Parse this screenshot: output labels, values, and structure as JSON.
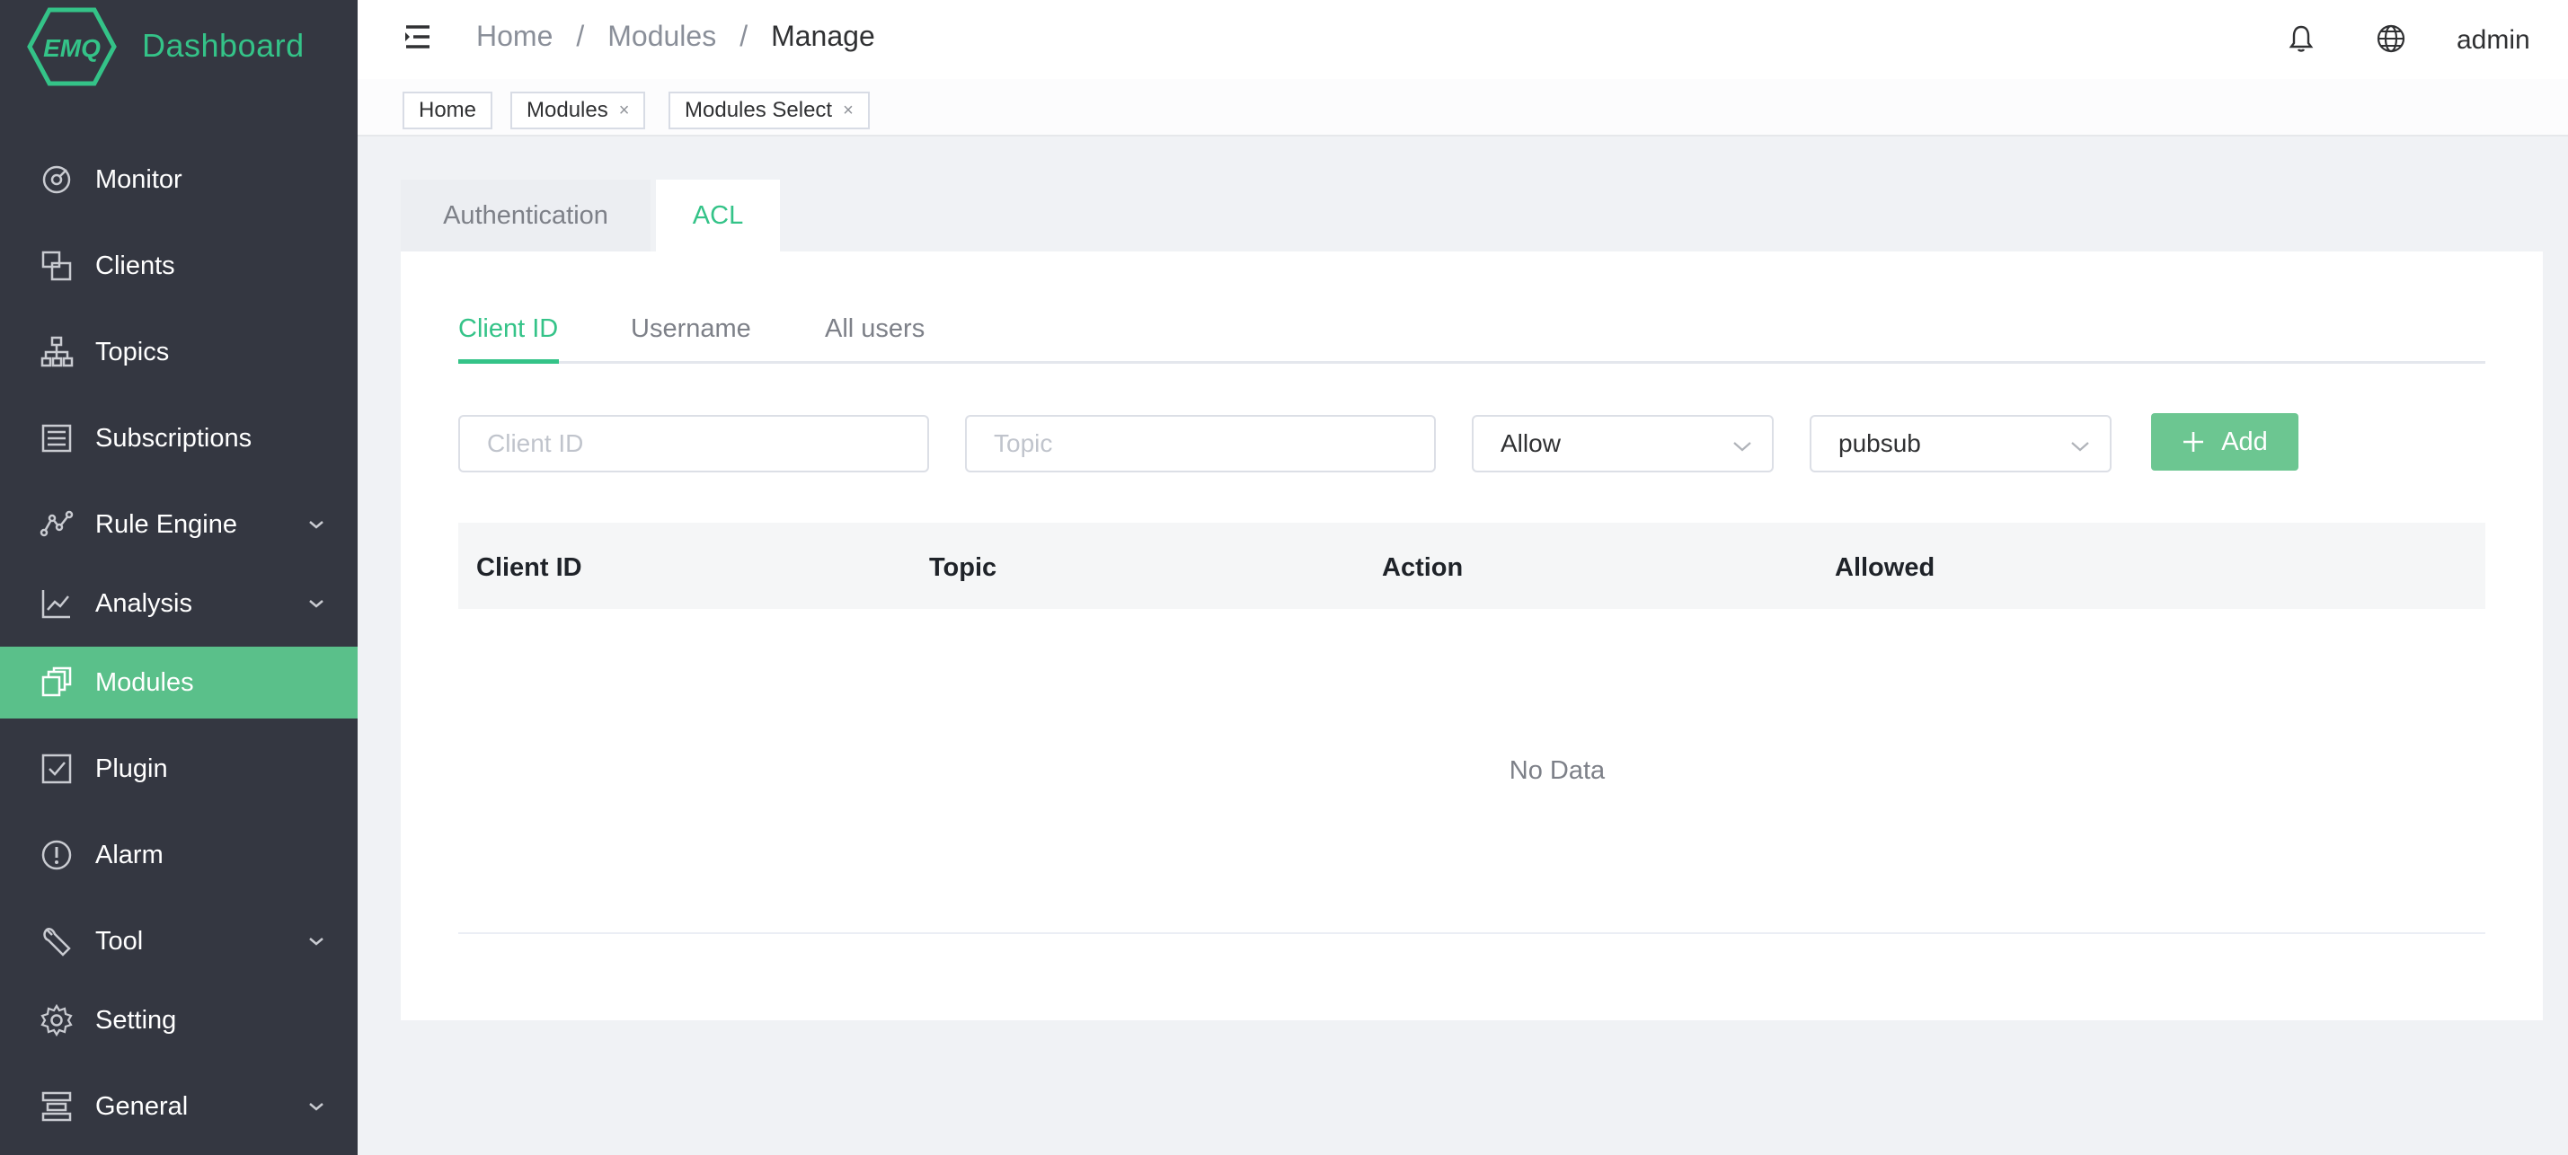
{
  "brand": {
    "logo_text": "EMQ",
    "title": "Dashboard"
  },
  "sidebar": {
    "items": [
      {
        "label": "Monitor",
        "icon": "dashboard-icon",
        "expandable": false,
        "active": false
      },
      {
        "label": "Clients",
        "icon": "clients-icon",
        "expandable": false,
        "active": false
      },
      {
        "label": "Topics",
        "icon": "topics-icon",
        "expandable": false,
        "active": false
      },
      {
        "label": "Subscriptions",
        "icon": "subscriptions-icon",
        "expandable": false,
        "active": false
      },
      {
        "label": "Rule Engine",
        "icon": "rule-engine-icon",
        "expandable": true,
        "active": false
      },
      {
        "label": "Analysis",
        "icon": "analysis-icon",
        "expandable": true,
        "active": false
      },
      {
        "label": "Modules",
        "icon": "modules-icon",
        "expandable": false,
        "active": true
      },
      {
        "label": "Plugin",
        "icon": "plugin-icon",
        "expandable": false,
        "active": false
      },
      {
        "label": "Alarm",
        "icon": "alarm-icon",
        "expandable": false,
        "active": false
      },
      {
        "label": "Tool",
        "icon": "tool-icon",
        "expandable": true,
        "active": false
      },
      {
        "label": "Setting",
        "icon": "gear-icon",
        "expandable": false,
        "active": false
      },
      {
        "label": "General",
        "icon": "general-icon",
        "expandable": true,
        "active": false
      }
    ]
  },
  "header": {
    "breadcrumb": [
      "Home",
      "Modules",
      "Manage"
    ],
    "separator": "/",
    "user": "admin"
  },
  "tags": [
    {
      "label": "Home",
      "closable": false
    },
    {
      "label": "Modules",
      "closable": true
    },
    {
      "label": "Modules Select",
      "closable": true
    }
  ],
  "tag_close_glyph": "×",
  "module_tabs": [
    {
      "label": "Authentication",
      "active": false
    },
    {
      "label": "ACL",
      "active": true
    }
  ],
  "acl_tabs": [
    {
      "label": "Client ID",
      "active": true
    },
    {
      "label": "Username",
      "active": false
    },
    {
      "label": "All users",
      "active": false
    }
  ],
  "form": {
    "client_id_placeholder": "Client ID",
    "topic_placeholder": "Topic",
    "access_value": "Allow",
    "action_value": "pubsub",
    "add_label": "Add"
  },
  "table": {
    "columns": [
      "Client ID",
      "Topic",
      "Action",
      "Allowed"
    ],
    "rows": [],
    "empty_text": "No Data"
  },
  "colors": {
    "accent": "#34c388",
    "sidebar_bg": "#343741",
    "active_item_bg": "#5ac08a",
    "add_button_bg": "#6cc691"
  }
}
